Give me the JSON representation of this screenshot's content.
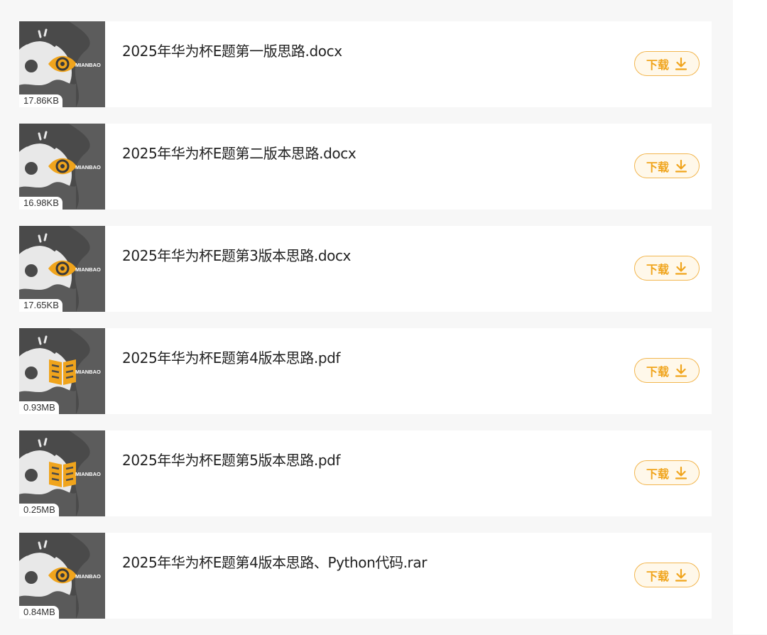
{
  "files": [
    {
      "name": "2025年华为杯E题第一版思路.docx",
      "size": "17.86KB",
      "type_icon": "eye-icon",
      "button_label": "下载"
    },
    {
      "name": "2025年华为杯E题第二版本思路.docx",
      "size": "16.98KB",
      "type_icon": "eye-icon",
      "button_label": "下载"
    },
    {
      "name": "2025年华为杯E题第3版本思路.docx",
      "size": "17.65KB",
      "type_icon": "eye-icon",
      "button_label": "下载"
    },
    {
      "name": "2025年华为杯E题第4版本思路.pdf",
      "size": "0.93MB",
      "type_icon": "book-icon",
      "button_label": "下载"
    },
    {
      "name": "2025年华为杯E题第5版本思路.pdf",
      "size": "0.25MB",
      "type_icon": "book-icon",
      "button_label": "下载"
    },
    {
      "name": "2025年华为杯E题第4版本思路、Python代码.rar",
      "size": "0.84MB",
      "type_icon": "eye-icon",
      "button_label": "下载"
    }
  ],
  "thumb_brand": "MIANBAO",
  "colors": {
    "accent": "#f0a41c",
    "accent_border": "#f2b64f",
    "button_bg": "#fff8ea",
    "thumb_dark": "#4a4a4a"
  }
}
